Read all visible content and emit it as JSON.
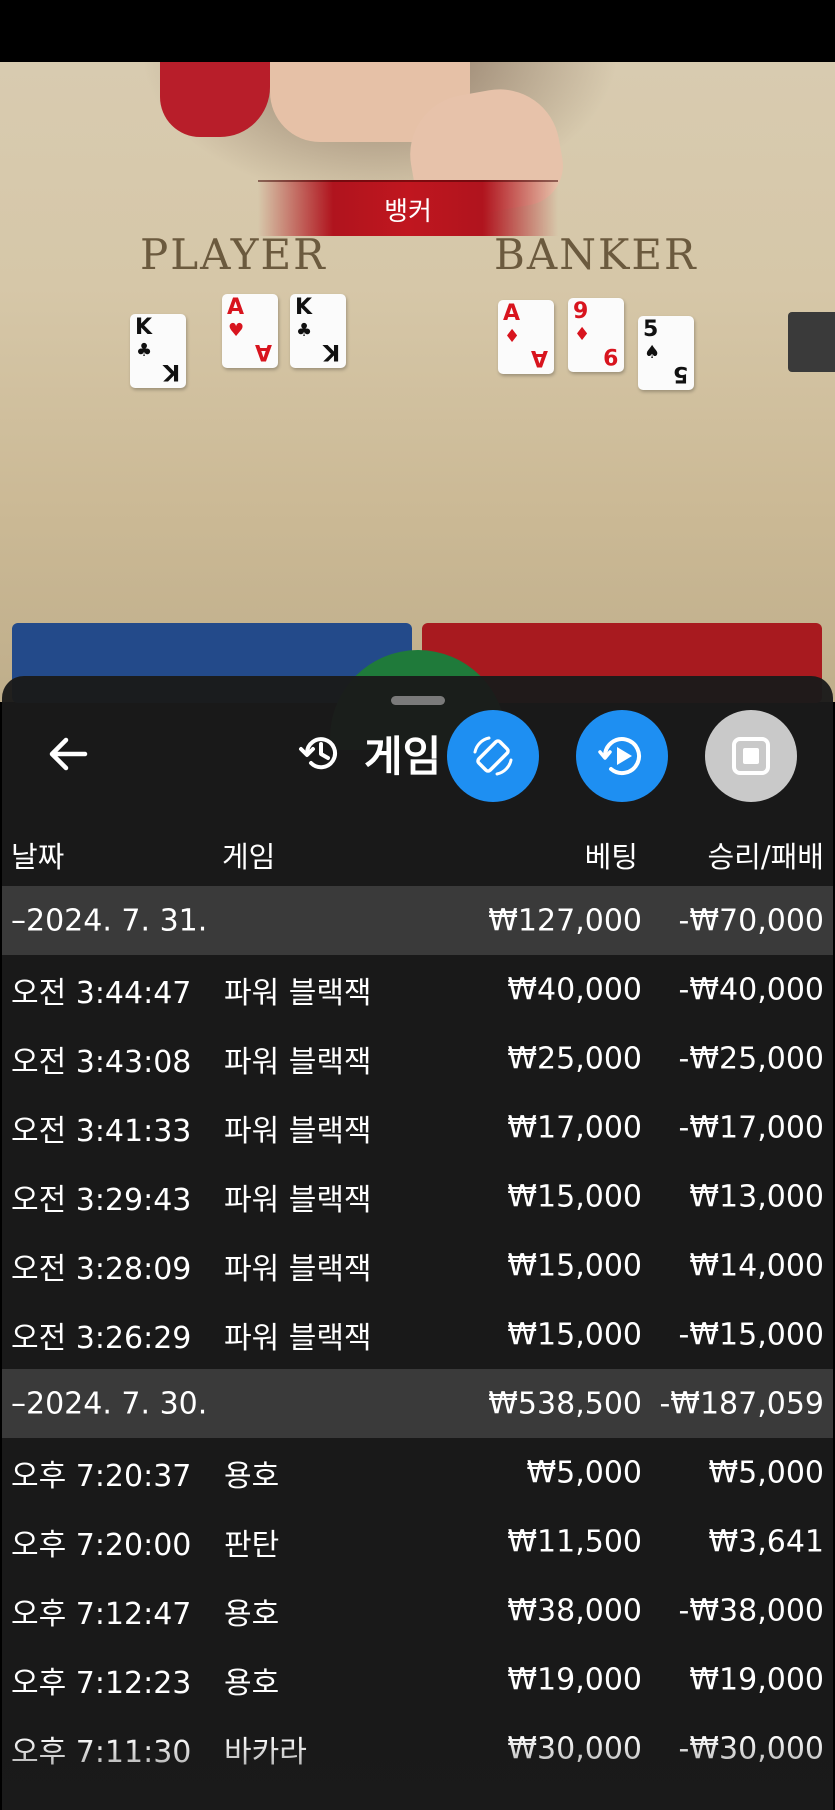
{
  "video": {
    "banner": "뱅커",
    "player_label": "PLAYER",
    "banker_label": "BANKER",
    "player_cards": [
      {
        "rank": "K",
        "suit": "♣",
        "color": "#111111"
      },
      {
        "rank": "A",
        "suit": "♥",
        "color": "#d8141e"
      },
      {
        "rank": "K",
        "suit": "♣",
        "color": "#111111"
      }
    ],
    "banker_cards": [
      {
        "rank": "A",
        "suit": "♦",
        "color": "#d8141e"
      },
      {
        "rank": "9",
        "suit": "♦",
        "color": "#d8141e"
      },
      {
        "rank": "5",
        "suit": "♠",
        "color": "#111111"
      }
    ]
  },
  "sheet": {
    "title": "게임",
    "back_icon": "arrow-left-icon",
    "history_icon": "history-icon",
    "actions": [
      {
        "name": "rotate-device-icon",
        "color": "#1e8ff2"
      },
      {
        "name": "replay-icon",
        "color": "#1e8ff2"
      },
      {
        "name": "stop-icon",
        "color": "#c9c9c9"
      }
    ],
    "columns": {
      "date": "날짜",
      "game": "게임",
      "bet": "베팅",
      "result": "승리/패배"
    }
  },
  "history": [
    {
      "date": "–2024. 7. 31.",
      "bet_total": "₩127,000",
      "result_total": "-₩70,000",
      "rows": [
        {
          "time": "오전 3:44:47",
          "game": "파워 블랙잭",
          "bet": "₩40,000",
          "result": "-₩40,000"
        },
        {
          "time": "오전 3:43:08",
          "game": "파워 블랙잭",
          "bet": "₩25,000",
          "result": "-₩25,000"
        },
        {
          "time": "오전 3:41:33",
          "game": "파워 블랙잭",
          "bet": "₩17,000",
          "result": "-₩17,000"
        },
        {
          "time": "오전 3:29:43",
          "game": "파워 블랙잭",
          "bet": "₩15,000",
          "result": "₩13,000"
        },
        {
          "time": "오전 3:28:09",
          "game": "파워 블랙잭",
          "bet": "₩15,000",
          "result": "₩14,000"
        },
        {
          "time": "오전 3:26:29",
          "game": "파워 블랙잭",
          "bet": "₩15,000",
          "result": "-₩15,000"
        }
      ]
    },
    {
      "date": "–2024. 7. 30.",
      "bet_total": "₩538,500",
      "result_total": "-₩187,059",
      "rows": [
        {
          "time": "오후 7:20:37",
          "game": "용호",
          "bet": "₩5,000",
          "result": "₩5,000"
        },
        {
          "time": "오후 7:20:00",
          "game": "판탄",
          "bet": "₩11,500",
          "result": "₩3,641"
        },
        {
          "time": "오후 7:12:47",
          "game": "용호",
          "bet": "₩38,000",
          "result": "-₩38,000"
        },
        {
          "time": "오후 7:12:23",
          "game": "용호",
          "bet": "₩19,000",
          "result": "₩19,000"
        },
        {
          "time": "오후 7:11:30",
          "game": "바카라",
          "bet": "₩30,000",
          "result": "-₩30,000"
        }
      ]
    }
  ]
}
